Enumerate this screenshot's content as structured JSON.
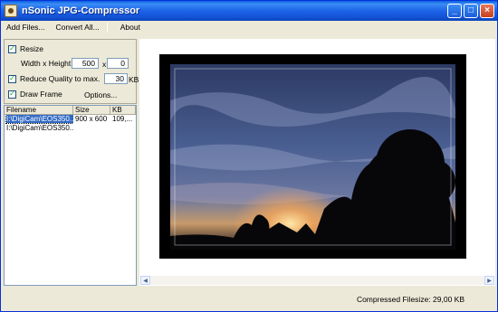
{
  "window": {
    "title": "nSonic JPG-Compressor"
  },
  "menu": {
    "add_files": "Add Files...",
    "convert_all": "Convert All...",
    "about": "About"
  },
  "options": {
    "resize": {
      "label": "Resize",
      "checked": true
    },
    "size_label": "Width x Height:",
    "width_value": "500",
    "times": "x",
    "height_value": "0",
    "reduce_quality": {
      "label": "Reduce Quality to max.",
      "checked": true
    },
    "quality_value": "30",
    "quality_unit": "KB",
    "draw_frame": {
      "label": "Draw Frame",
      "checked": true
    },
    "options_link": "Options..."
  },
  "filelist": {
    "columns": [
      "Filename",
      "Size",
      "KB"
    ],
    "rows": [
      {
        "filename": "I:\\DigiCam\\EOS350...",
        "size": "900 x 600",
        "kb": "109,...",
        "selected": true
      },
      {
        "filename": "I:\\DigiCam\\EOS350...",
        "size": "",
        "kb": "",
        "selected": false
      }
    ]
  },
  "status": {
    "compressed": "Compressed Filesize:   29,00 KB"
  },
  "colors": {
    "titlebar": "#1c63e8",
    "selection": "#316ac5",
    "window_bg": "#ece9d8"
  }
}
